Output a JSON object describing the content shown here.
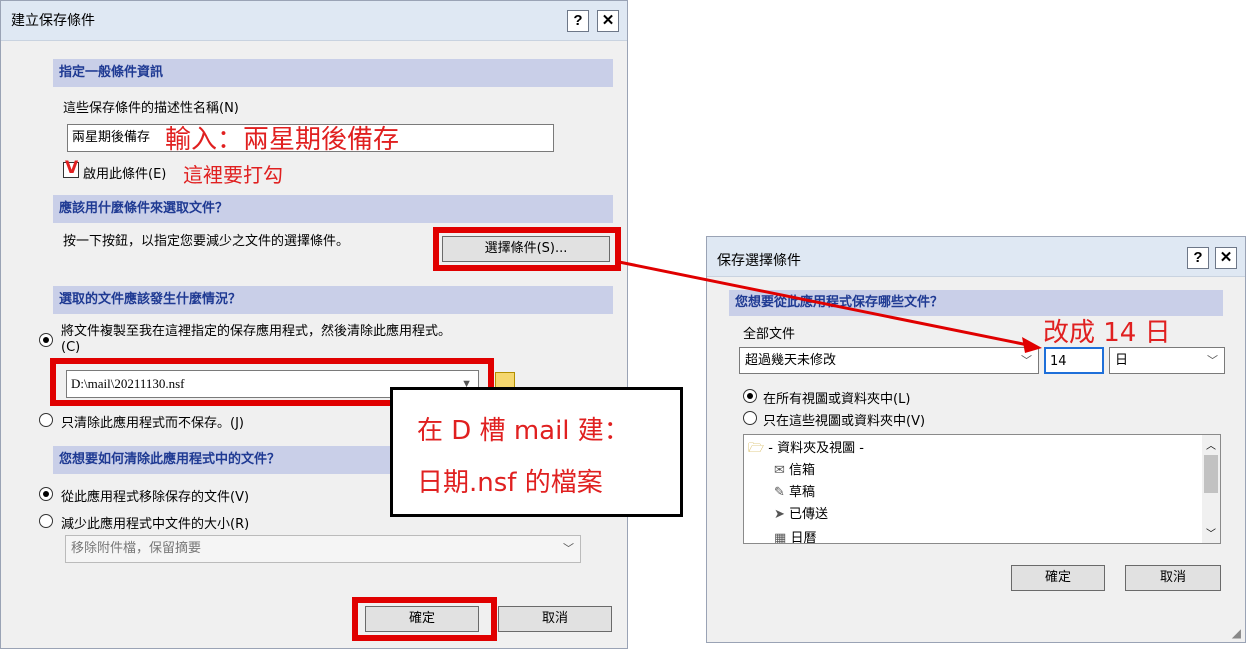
{
  "dialog1": {
    "title": "建立保存條件",
    "help_btn": "?",
    "close_btn": "✕",
    "section1": "指定一般條件資訊",
    "desc_label": "這些保存條件的描述性名稱(N)",
    "desc_value": "兩星期後備存",
    "enable_label": "啟用此條件(E)",
    "section2": "應該用什麼條件來選取文件？",
    "select_hint": "按一下按鈕，以指定您要減少之文件的選擇條件。",
    "select_btn": "選擇條件(S)...",
    "section3": "選取的文件應該發生什麼情況？",
    "radio_copy": "將文件複製至我在這裡指定的保存應用程式，然後清除此應用程式。(C)",
    "path_value": "D:\\mail\\20211130.nsf",
    "radio_clear": "只清除此應用程式而不保存。(J)",
    "section4": "您想要如何清除此應用程式中的文件？",
    "radio_remove": "從此應用程式移除保存的文件(V)",
    "radio_reduce": "減少此應用程式中文件的大小(R)",
    "reduce_select": "移除附件檔，保留摘要",
    "ok_btn": "確定",
    "cancel_btn": "取消"
  },
  "dialog2": {
    "title": "保存選擇條件",
    "help_btn": "?",
    "close_btn": "✕",
    "section": "您想要從此應用程式保存哪些文件？",
    "all_docs": "全部文件",
    "criteria_select": "超過幾天未修改",
    "days_value": "14",
    "unit_select": "日",
    "radio_all_views": "在所有視圖或資料夾中(L)",
    "radio_these_views": "只在這些視圖或資料夾中(V)",
    "tree": [
      {
        "label": "- 資料夾及視圖 -",
        "icon": "folder-open-icon"
      },
      {
        "label": "信箱",
        "icon": "inbox-icon"
      },
      {
        "label": "草稿",
        "icon": "draft-icon"
      },
      {
        "label": "已傳送",
        "icon": "sent-icon"
      },
      {
        "label": "日曆",
        "icon": "calendar-icon"
      }
    ],
    "ok_btn": "確定",
    "cancel_btn": "取消"
  },
  "annotations": {
    "input_note": "輸入：兩星期後備存",
    "check_note": "這裡要打勾",
    "change_note": "改成 14 日",
    "callout_line1": "在 D 槽 mail 建：",
    "callout_line2": "日期.nsf 的檔案",
    "check_mark": "V"
  },
  "colors": {
    "highlight_red": "#e00000",
    "section_bg": "#c9cfe8",
    "section_text": "#1f3a93"
  }
}
